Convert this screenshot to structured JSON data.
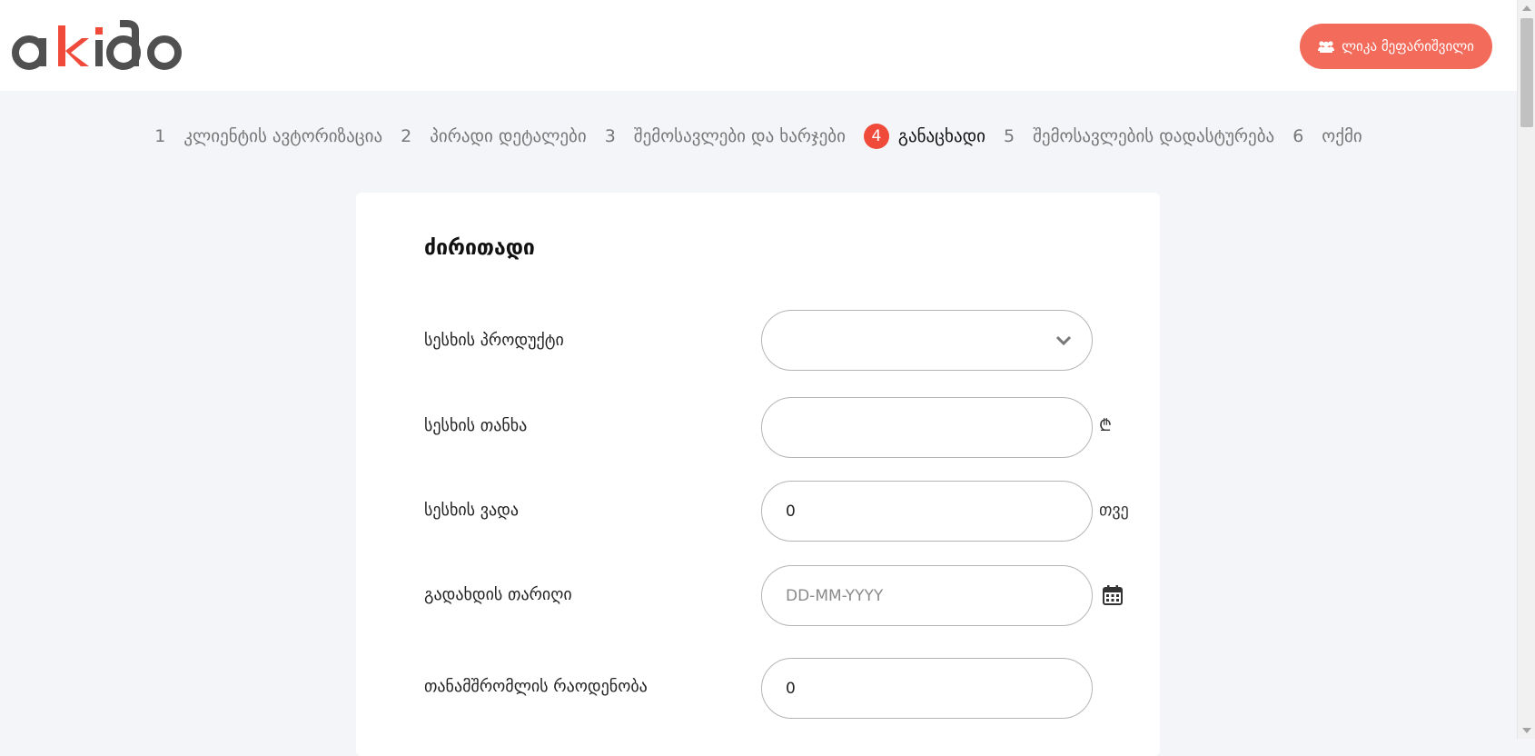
{
  "header": {
    "logo_text": "akido",
    "user_button_label": "ლიკა მეფარიშვილი"
  },
  "steps": [
    {
      "num": "1",
      "label": "კლიენტის ავტორიზაცია"
    },
    {
      "num": "2",
      "label": "პირადი დეტალები"
    },
    {
      "num": "3",
      "label": "შემოსავლები და ხარჯები"
    },
    {
      "num": "4",
      "label": "განაცხადი"
    },
    {
      "num": "5",
      "label": "შემოსავლების დადასტურება"
    },
    {
      "num": "6",
      "label": "ოქმი"
    }
  ],
  "active_step": "4",
  "form": {
    "section_title": "ძირითადი",
    "loan_product": {
      "label": "სესხის პროდუქტი",
      "value": ""
    },
    "loan_amount": {
      "label": "სესხის თანხა",
      "value": "",
      "suffix": "₾"
    },
    "loan_term": {
      "label": "სესხის ვადა",
      "value": "0",
      "suffix": "თვე"
    },
    "payment_date": {
      "label": "გადახდის თარიღი",
      "value": "",
      "placeholder": "DD-MM-YYYY"
    },
    "employee_count": {
      "label": "თანამშრომლის რაოდენობა",
      "value": "0"
    }
  },
  "colors": {
    "accent": "#ef4a3a",
    "user_button": "#f26b5b",
    "background": "#f4f5f8"
  },
  "icons": {
    "user": "users-icon",
    "select": "chevron-down-icon",
    "date": "calendar-icon"
  }
}
